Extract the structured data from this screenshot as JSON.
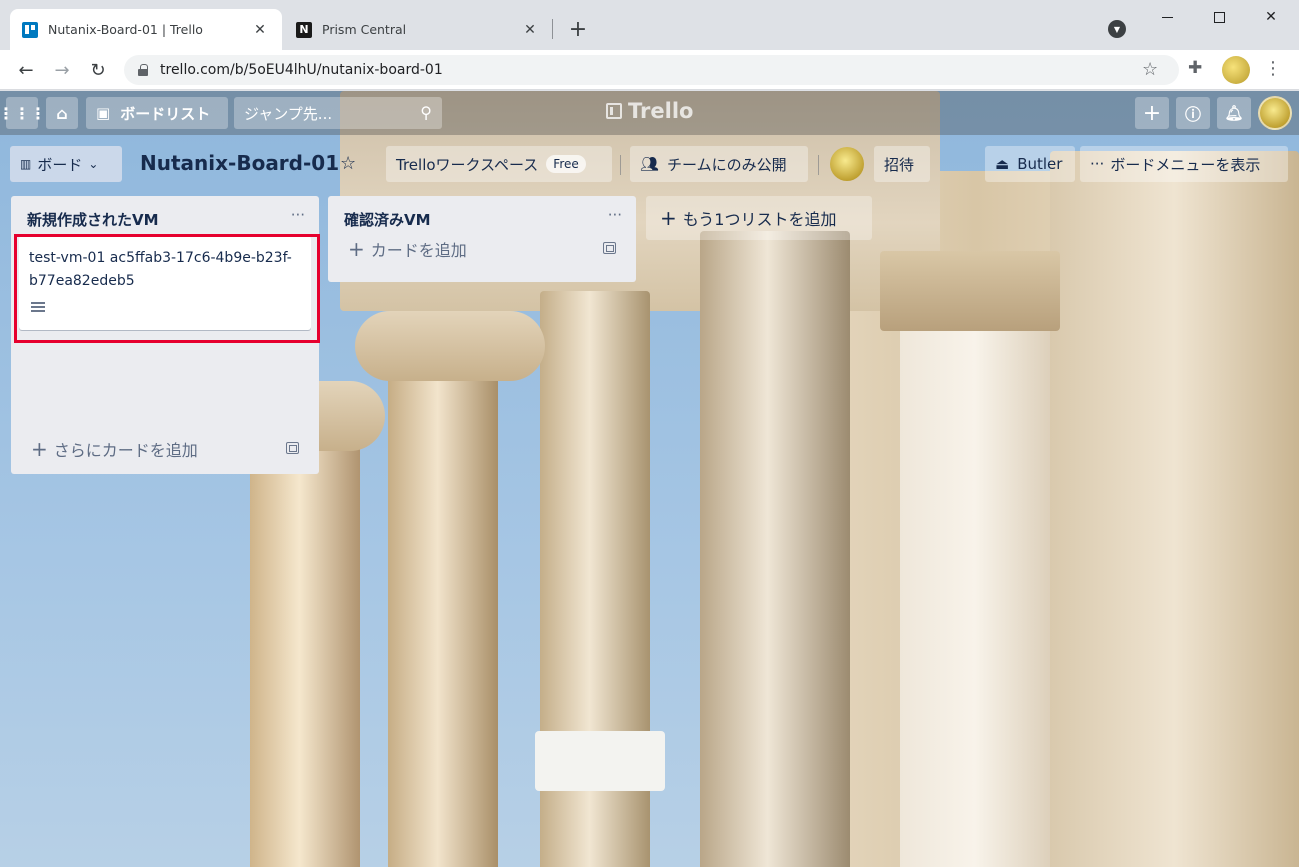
{
  "browser": {
    "tabs": [
      {
        "title": "Nutanix-Board-01 | Trello",
        "close": "✕"
      },
      {
        "title": "Prism Central",
        "close": "✕"
      }
    ],
    "new_tab": "+",
    "url": "trello.com/b/5oEU4lhU/nutanix-board-01"
  },
  "appbar": {
    "boards_label": "ボードリスト",
    "search_placeholder": "ジャンプ先...",
    "logo": "Trello"
  },
  "boardbar": {
    "view_label": "ボード",
    "board_title": "Nutanix-Board-01",
    "workspace": "Trelloワークスペース",
    "workspace_badge": "Free",
    "visibility": "チームにのみ公開",
    "invite": "招待",
    "butler": "Butler",
    "menu": "ボードメニューを表示"
  },
  "lists": [
    {
      "title": "新規作成されたVM",
      "menu": "···",
      "cards": [
        {
          "text": "test-vm-01 ac5ffab3-17c6-4b9e-b23f-b77ea82edeb5",
          "has_description": true
        }
      ],
      "add_card": "さらにカードを追加"
    },
    {
      "title": "確認済みVM",
      "menu": "···",
      "cards": [],
      "add_card": "カードを追加"
    }
  ],
  "add_list": "もう1つリストを追加",
  "colors": {
    "highlight": "#e6002e",
    "list_bg": "#ebecf0",
    "text": "#172b4d"
  }
}
